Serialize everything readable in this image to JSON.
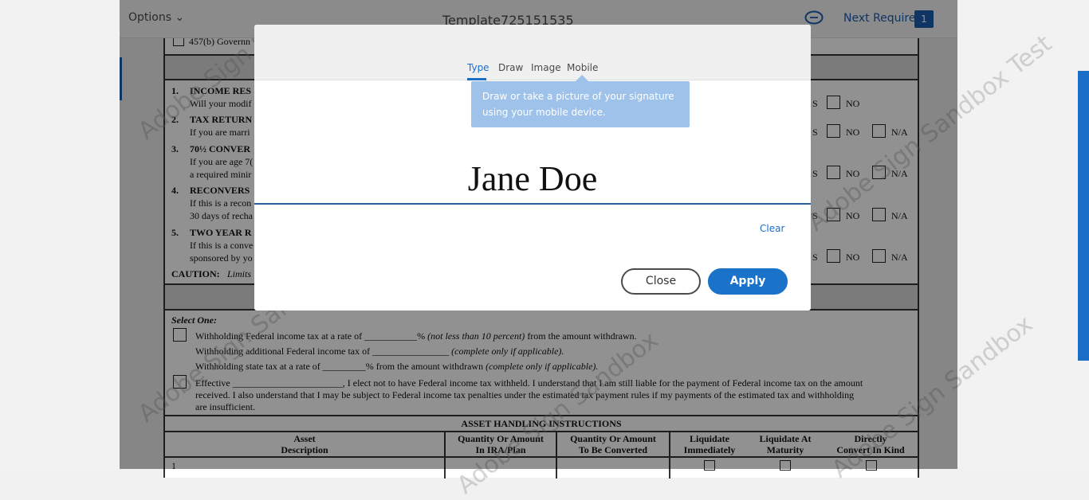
{
  "toolbar": {
    "options_label": "Options",
    "document_title": "Template725151535",
    "next_required_label": "Next Required",
    "next_required_count": "1"
  },
  "watermark": {
    "sandbox": "Adobe Sign Sandbox",
    "test": "Adobe Sign Sandbox Test"
  },
  "form": {
    "top_item": "457(b) Governn",
    "items": [
      {
        "num": "1.",
        "title": "INCOME RES",
        "line1": "Will your modif",
        "line2": ""
      },
      {
        "num": "2.",
        "title": "TAX RETURN",
        "line1": "If you are marri",
        "line2": ""
      },
      {
        "num": "3.",
        "title": "70½ CONVER",
        "line1": "If you are age 7(",
        "line2": "a required minir"
      },
      {
        "num": "4.",
        "title": "RECONVERS",
        "line1": "If this is a recon",
        "line2": "30 days of recha"
      },
      {
        "num": "5.",
        "title": "TWO YEAR R",
        "line1": "If this is a conve",
        "line2": "sponsored by yo"
      }
    ],
    "caution_label": "CAUTION:",
    "caution_text": "Limits",
    "answer_rows": [
      {
        "yes": "S",
        "no": "NO",
        "na": ""
      },
      {
        "yes": "S",
        "no": "NO",
        "na": "N/A"
      },
      {
        "yes": "S",
        "no": "NO",
        "na": "N/A"
      },
      {
        "yes": "S",
        "no": "NO",
        "na": "N/A"
      },
      {
        "yes": "S",
        "no": "NO",
        "na": "N/A"
      }
    ],
    "select_one": "Select One:",
    "withholding_1a": "Withholding Federal income tax at a rate of ___________% ",
    "withholding_1b": "(not less than 10 percent)",
    "withholding_1c": " from the amount withdrawn.",
    "withholding_2a": "Withholding additional Federal income tax of ________________ ",
    "withholding_2b": "(complete only if applicable).",
    "withholding_3a": "Withholding state tax at a rate of _________% from the amount withdrawn ",
    "withholding_3b": "(complete only if applicable).",
    "effective_1": "Effective _______________________, I elect not to have Federal income tax withheld. I understand that I am still liable for the payment of Federal income tax on the amount",
    "effective_2": "received. I also understand that I may be subject to Federal income tax penalties under the estimated tax payment rules if my payments of the estimated tax and withholding",
    "effective_3": "are insufficient.",
    "asset_heading": "ASSET HANDLING INSTRUCTIONS",
    "asset_columns": [
      {
        "l1": "Asset",
        "l2": "Description"
      },
      {
        "l1": "Quantity Or Amount",
        "l2": "In IRA/Plan"
      },
      {
        "l1": "Quantity Or Amount",
        "l2": "To Be Converted"
      },
      {
        "l1": "Liquidate",
        "l2": "Immediately"
      },
      {
        "l1": "Liquidate At",
        "l2": "Maturity"
      },
      {
        "l1": "Directly",
        "l2": "Convert In Kind"
      }
    ],
    "asset_row_num": "1"
  },
  "signature_dialog": {
    "tabs": [
      "Type",
      "Draw",
      "Image",
      "Mobile"
    ],
    "active_tab": "Type",
    "tooltip_text": "Draw or take a picture of your signature using your mobile device.",
    "signature_value": "Jane Doe",
    "clear_label": "Clear",
    "close_label": "Close",
    "apply_label": "Apply"
  },
  "colors": {
    "accent": "#1a6ec8",
    "tooltip": "#9ec2ea",
    "overlay": "rgba(0,0,0,0.43)"
  }
}
